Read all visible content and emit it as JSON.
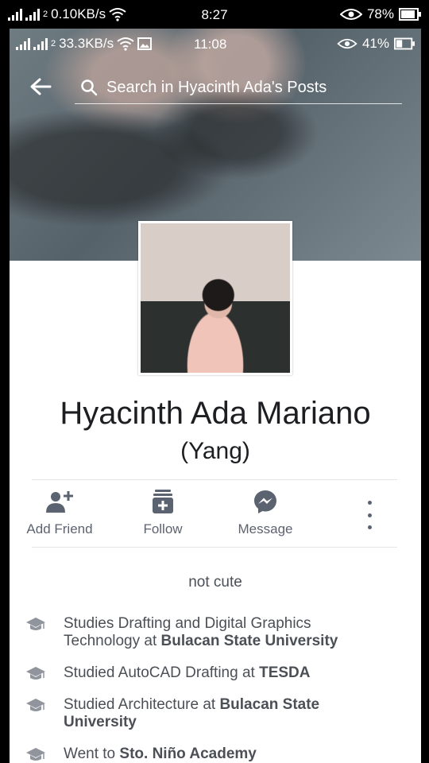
{
  "outer_status": {
    "network_speed": "0.10KB/s",
    "sim_label": "2",
    "time": "8:27",
    "battery": "78%"
  },
  "inner_status": {
    "network_speed": "33.3KB/s",
    "sim_label": "2",
    "time": "11:08",
    "battery": "41%"
  },
  "search": {
    "placeholder": "Search in Hyacinth Ada's Posts"
  },
  "profile": {
    "name": "Hyacinth Ada Mariano",
    "nickname": "(Yang)",
    "bio": "not cute"
  },
  "actions": [
    {
      "label": "Add Friend",
      "icon": "add-friend-icon"
    },
    {
      "label": "Follow",
      "icon": "follow-icon"
    },
    {
      "label": "Message",
      "icon": "messenger-icon"
    }
  ],
  "info": [
    {
      "icon": "graduation-cap-icon",
      "prefix": "Studies Drafting and Digital Graphics Technology at ",
      "bold": "Bulacan State University"
    },
    {
      "icon": "graduation-cap-icon",
      "prefix": "Studied AutoCAD Drafting at ",
      "bold": "TESDA"
    },
    {
      "icon": "graduation-cap-icon",
      "prefix": "Studied Architecture at ",
      "bold": "Bulacan State University"
    },
    {
      "icon": "graduation-cap-icon",
      "prefix": "Went to ",
      "bold": "Sto. Niño Academy"
    }
  ],
  "colors": {
    "text_primary": "#1c1e21",
    "text_secondary": "#4b4f56",
    "icon_gray": "#5c6370"
  }
}
